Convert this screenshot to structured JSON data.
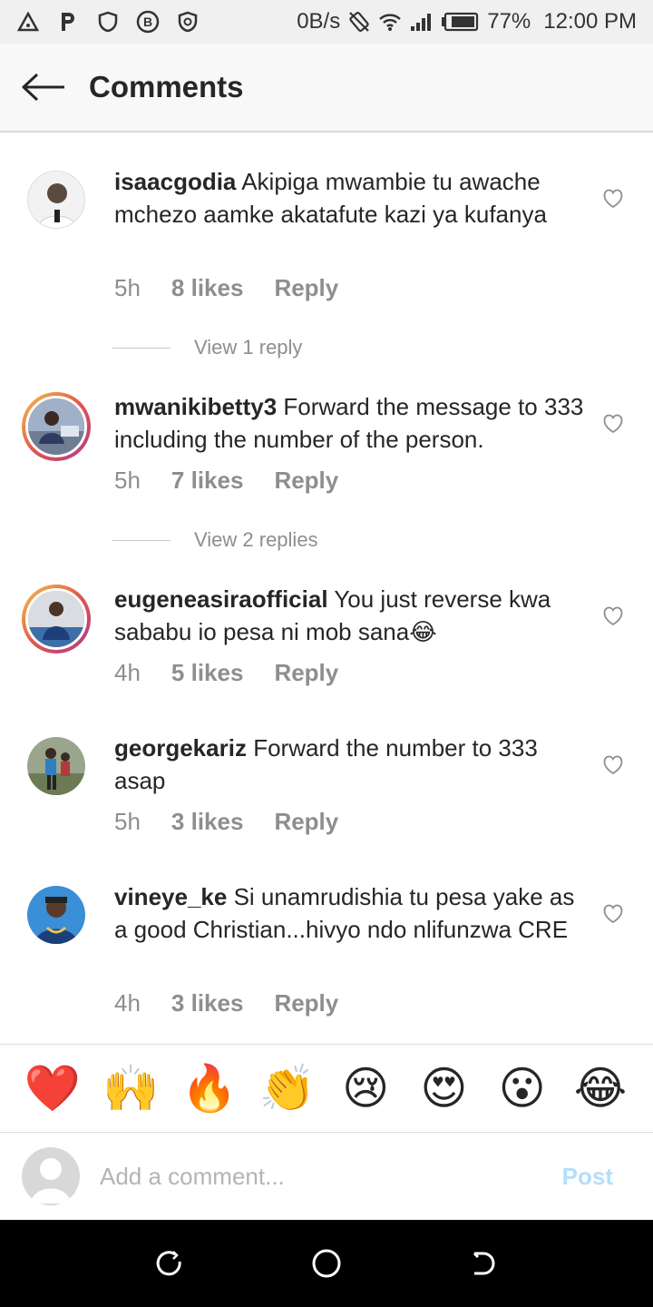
{
  "status_bar": {
    "network_speed": "0B/s",
    "battery": "77%",
    "time": "12:00 PM",
    "icons": [
      "warning-triangle-icon",
      "parking-icon",
      "shield-icon",
      "bitcoin-icon",
      "shield-check-icon",
      "vibrate-icon",
      "wifi-icon",
      "signal-icon",
      "battery-icon"
    ]
  },
  "header": {
    "title": "Comments",
    "back_icon": "arrow-left-icon"
  },
  "comments": [
    {
      "username": "isaacgodia",
      "text": "Akipiga mwambie tu awache mchezo aamke akatafute kazi ya kufanya",
      "time": "5h",
      "likes": "8 likes",
      "reply": "Reply",
      "view_replies": "View 1 reply"
    },
    {
      "username": "mwanikibetty3",
      "text": "Forward the message to 333 including the number of the person.",
      "time": "5h",
      "likes": "7 likes",
      "reply": "Reply",
      "view_replies": "View 2 replies"
    },
    {
      "username": "eugeneasiraofficial",
      "text": "You just reverse kwa sababu io pesa ni mob sana😂",
      "time": "4h",
      "likes": "5 likes",
      "reply": "Reply"
    },
    {
      "username": "georgekariz",
      "text": "Forward the number to 333 asap",
      "time": "5h",
      "likes": "3 likes",
      "reply": "Reply"
    },
    {
      "username": "vineye_ke",
      "text": "Si unamrudishia tu pesa yake as a good Christian...hivyo ndo nlifunzwa CRE",
      "time": "4h",
      "likes": "3 likes",
      "reply": "Reply"
    }
  ],
  "emoji_bar": [
    "❤️",
    "🙌",
    "🔥",
    "👏",
    "😢",
    "😍",
    "😮",
    "😂"
  ],
  "input": {
    "placeholder": "Add a comment...",
    "post_label": "Post"
  },
  "colors": {
    "accent_post": "#b2dffc",
    "muted_text": "#8e8e8e",
    "primary_text": "#262626"
  }
}
